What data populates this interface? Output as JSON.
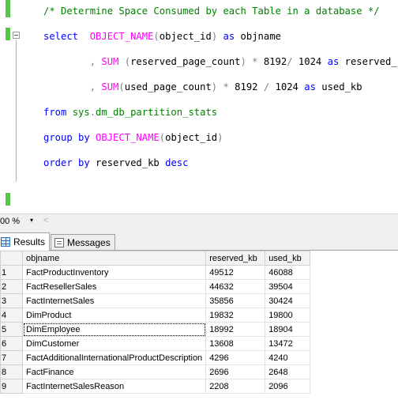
{
  "editor": {
    "lines": [
      {
        "parts": [
          {
            "t": "/* Determine Space Consumed by each Table in a database */",
            "c": "cm"
          }
        ]
      },
      {
        "parts": [
          {
            "t": "select  ",
            "c": "kw"
          },
          {
            "t": "OBJECT_NAME",
            "c": "fn"
          },
          {
            "t": "(",
            "c": "op"
          },
          {
            "t": "object_id",
            "c": "id"
          },
          {
            "t": ")",
            "c": "op"
          },
          {
            "t": " as ",
            "c": "kw"
          },
          {
            "t": "objname",
            "c": "id"
          }
        ]
      },
      {
        "parts": [
          {
            "t": "        , ",
            "c": "op"
          },
          {
            "t": "SUM",
            "c": "fn"
          },
          {
            "t": " (",
            "c": "op"
          },
          {
            "t": "reserved_page_count",
            "c": "id"
          },
          {
            "t": ")",
            "c": "op"
          },
          {
            "t": " * ",
            "c": "op"
          },
          {
            "t": "8192",
            "c": "id"
          },
          {
            "t": "/ ",
            "c": "op"
          },
          {
            "t": "1024",
            "c": "id"
          },
          {
            "t": " as ",
            "c": "kw"
          },
          {
            "t": "reserved_kb",
            "c": "id"
          }
        ]
      },
      {
        "parts": [
          {
            "t": "        , ",
            "c": "op"
          },
          {
            "t": "SUM",
            "c": "fn"
          },
          {
            "t": "(",
            "c": "op"
          },
          {
            "t": "used_page_count",
            "c": "id"
          },
          {
            "t": ")",
            "c": "op"
          },
          {
            "t": " * ",
            "c": "op"
          },
          {
            "t": "8192",
            "c": "id"
          },
          {
            "t": " / ",
            "c": "op"
          },
          {
            "t": "1024",
            "c": "id"
          },
          {
            "t": " as ",
            "c": "kw"
          },
          {
            "t": "used_kb",
            "c": "id"
          }
        ]
      },
      {
        "parts": [
          {
            "t": "from ",
            "c": "kw"
          },
          {
            "t": "sys",
            "c": "sys"
          },
          {
            "t": ".",
            "c": "op"
          },
          {
            "t": "dm_db_partition_stats",
            "c": "sys"
          }
        ]
      },
      {
        "parts": [
          {
            "t": "group by ",
            "c": "kw"
          },
          {
            "t": "OBJECT_NAME",
            "c": "fn"
          },
          {
            "t": "(",
            "c": "op"
          },
          {
            "t": "object_id",
            "c": "id"
          },
          {
            "t": ")",
            "c": "op"
          }
        ]
      },
      {
        "parts": [
          {
            "t": "order by ",
            "c": "kw"
          },
          {
            "t": "reserved_kb",
            "c": "id"
          },
          {
            "t": " desc",
            "c": "kw"
          }
        ]
      }
    ]
  },
  "zoom": {
    "value": "00 %",
    "arrow": "▾",
    "scroll_left": "<"
  },
  "tabs": [
    {
      "label": "Results",
      "active": true,
      "icon": "results-grid-icon"
    },
    {
      "label": "Messages",
      "active": false,
      "icon": "messages-icon"
    }
  ],
  "grid": {
    "columns": [
      "objname",
      "reserved_kb",
      "used_kb"
    ],
    "rows": [
      {
        "n": "1",
        "objname": "FactProductInventory",
        "reserved_kb": "49512",
        "used_kb": "46088"
      },
      {
        "n": "2",
        "objname": "FactResellerSales",
        "reserved_kb": "44632",
        "used_kb": "39504"
      },
      {
        "n": "3",
        "objname": "FactInternetSales",
        "reserved_kb": "35856",
        "used_kb": "30424"
      },
      {
        "n": "4",
        "objname": "DimProduct",
        "reserved_kb": "19832",
        "used_kb": "19800"
      },
      {
        "n": "5",
        "objname": "DimEmployee",
        "reserved_kb": "18992",
        "used_kb": "18904"
      },
      {
        "n": "6",
        "objname": "DimCustomer",
        "reserved_kb": "13608",
        "used_kb": "13472"
      },
      {
        "n": "7",
        "objname": "FactAdditionalInternationalProductDescription",
        "reserved_kb": "4296",
        "used_kb": "4240"
      },
      {
        "n": "8",
        "objname": "FactFinance",
        "reserved_kb": "2696",
        "used_kb": "2648"
      },
      {
        "n": "9",
        "objname": "FactInternetSalesReason",
        "reserved_kb": "2208",
        "used_kb": "2096"
      }
    ],
    "selected_row": 4
  }
}
